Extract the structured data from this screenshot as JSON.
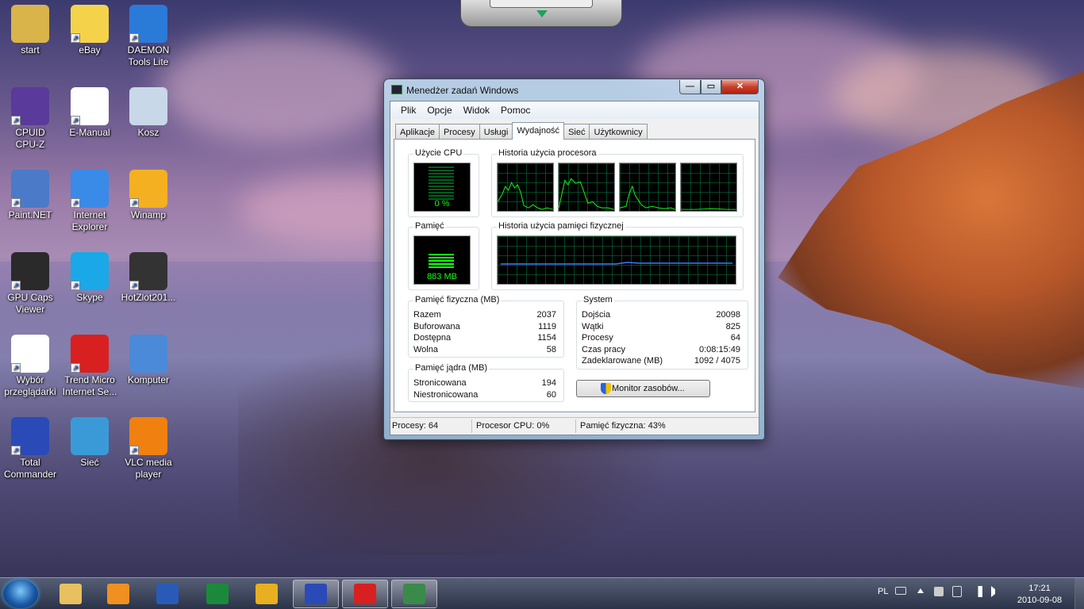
{
  "desktop": {
    "icons": [
      {
        "label": "start",
        "icon": "user-folder-icon",
        "color": "#d8b44a"
      },
      {
        "label": "eBay",
        "icon": "ebay-icon",
        "color": "#f4d34a"
      },
      {
        "label": "DAEMON\nTools Lite",
        "icon": "daemon-tools-icon",
        "color": "#2a7ad8"
      },
      {
        "label": "CPUID\nCPU-Z",
        "icon": "cpu-z-icon",
        "color": "#5a3a9a"
      },
      {
        "label": "E-Manual",
        "icon": "pdf-manual-icon",
        "color": "#ffffff"
      },
      {
        "label": "Kosz",
        "icon": "recycle-bin-icon",
        "color": "#c8d8e8"
      },
      {
        "label": "Paint.NET",
        "icon": "paintnet-icon",
        "color": "#4a7ac8"
      },
      {
        "label": "Internet\nExplorer",
        "icon": "internet-explorer-icon",
        "color": "#3a8ae8"
      },
      {
        "label": "Winamp",
        "icon": "winamp-icon",
        "color": "#f4b020"
      },
      {
        "label": "GPU Caps\nViewer",
        "icon": "gpu-caps-icon",
        "color": "#2a2a2a"
      },
      {
        "label": "Skype",
        "icon": "skype-icon",
        "color": "#1aa8e8"
      },
      {
        "label": "HotZlot201...",
        "icon": "video-file-icon",
        "color": "#333333"
      },
      {
        "label": "Wybór\nprzeglądarki",
        "icon": "browser-choice-icon",
        "color": "#ffffff"
      },
      {
        "label": "Trend Micro\nInternet Se...",
        "icon": "trend-micro-icon",
        "color": "#d82020"
      },
      {
        "label": "Komputer",
        "icon": "computer-icon",
        "color": "#4a8ad8"
      },
      {
        "label": "Total\nCommander",
        "icon": "total-commander-icon",
        "color": "#2a4ab8"
      },
      {
        "label": "Sieć",
        "icon": "network-icon",
        "color": "#3a9ad8"
      },
      {
        "label": "VLC media\nplayer",
        "icon": "vlc-icon",
        "color": "#f08010"
      }
    ]
  },
  "window": {
    "title": "Menedżer zadań Windows",
    "buttons": {
      "minimize": "—",
      "maximize": "▭",
      "close": "✕"
    },
    "menu": [
      "Plik",
      "Opcje",
      "Widok",
      "Pomoc"
    ],
    "tabs": [
      "Aplikacje",
      "Procesy",
      "Usługi",
      "Wydajność",
      "Sieć",
      "Użytkownicy"
    ],
    "active_tab": "Wydajność",
    "cpu_usage": {
      "label": "Użycie CPU",
      "value": "0 %",
      "percent": 0
    },
    "cpu_history": {
      "label": "Historia użycia procesora",
      "cores": 4
    },
    "memory": {
      "label": "Pamięć",
      "value": "883 MB",
      "percent": 43
    },
    "memory_history": {
      "label": "Historia użycia pamięci fizycznej"
    },
    "physical_memory": {
      "label": "Pamięć fizyczna (MB)",
      "rows": [
        {
          "k": "Razem",
          "v": "2037"
        },
        {
          "k": "Buforowana",
          "v": "1119"
        },
        {
          "k": "Dostępna",
          "v": "1154"
        },
        {
          "k": "Wolna",
          "v": "58"
        }
      ]
    },
    "kernel_memory": {
      "label": "Pamięć jądra (MB)",
      "rows": [
        {
          "k": "Stronicowana",
          "v": "194"
        },
        {
          "k": "Niestronicowana",
          "v": "60"
        }
      ]
    },
    "system": {
      "label": "System",
      "rows": [
        {
          "k": "Dojścia",
          "v": "20098"
        },
        {
          "k": "Wątki",
          "v": "825"
        },
        {
          "k": "Procesy",
          "v": "64"
        },
        {
          "k": "Czas pracy",
          "v": "0:08:15:49"
        },
        {
          "k": "Zadeklarowane (MB)",
          "v": "1092 / 4075"
        }
      ]
    },
    "resource_monitor_button": "Monitor zasobów...",
    "status": {
      "processes": "Procesy: 64",
      "cpu": "Procesor CPU: 0%",
      "memory": "Pamięć fizyczna: 43%"
    }
  },
  "taskbar": {
    "pinned": [
      {
        "icon": "explorer-icon",
        "color": "#e8c060",
        "open": false
      },
      {
        "icon": "media-player-icon",
        "color": "#f09020",
        "open": false
      },
      {
        "icon": "word-icon",
        "color": "#2a5ab8",
        "open": false
      },
      {
        "icon": "excel-icon",
        "color": "#1a8a3a",
        "open": false
      },
      {
        "icon": "outlook-icon",
        "color": "#e8b020",
        "open": false
      },
      {
        "icon": "total-commander-icon",
        "color": "#2a4ab8",
        "open": true
      },
      {
        "icon": "trend-micro-icon",
        "color": "#d82020",
        "open": true
      },
      {
        "icon": "task-manager-icon",
        "color": "#3a8a4a",
        "open": true
      }
    ],
    "language": "PL",
    "time": "17:21",
    "date": "2010-09-08"
  }
}
